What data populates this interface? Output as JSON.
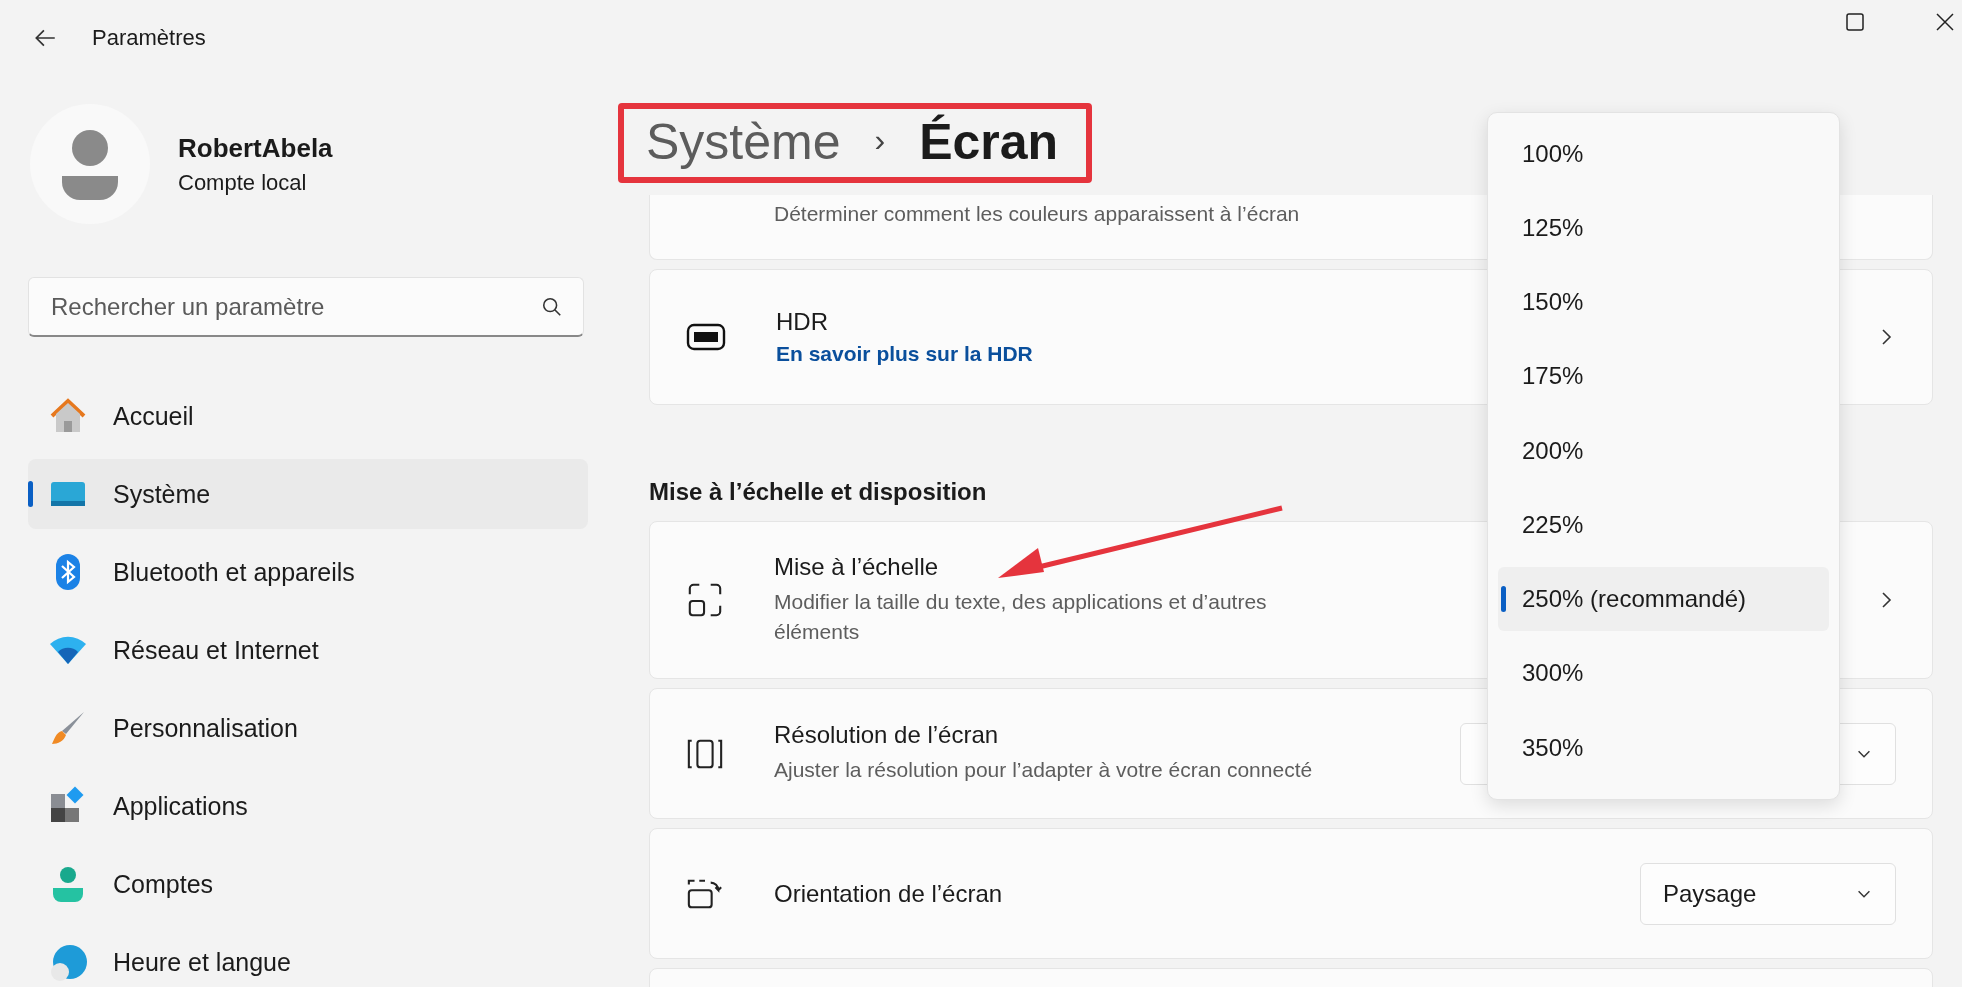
{
  "window": {
    "title": "Paramètres"
  },
  "profile": {
    "name": "RobertAbela",
    "account": "Compte local"
  },
  "search": {
    "placeholder": "Rechercher un paramètre"
  },
  "sidebar": {
    "items": [
      {
        "label": "Accueil",
        "selected": false
      },
      {
        "label": "Système",
        "selected": true
      },
      {
        "label": "Bluetooth et appareils",
        "selected": false
      },
      {
        "label": "Réseau et Internet",
        "selected": false
      },
      {
        "label": "Personnalisation",
        "selected": false
      },
      {
        "label": "Applications",
        "selected": false
      },
      {
        "label": "Comptes",
        "selected": false
      },
      {
        "label": "Heure et langue",
        "selected": false
      }
    ]
  },
  "breadcrumb": {
    "parent": "Système",
    "separator": "›",
    "current": "Écran",
    "highlighted": true
  },
  "cards": [
    {
      "kind": "partial",
      "description": "Déterminer comment les couleurs apparaissent à l’écran"
    },
    {
      "kind": "link",
      "title": "HDR",
      "link": "En savoir plus sur la HDR"
    },
    {
      "kind": "heading",
      "title": "Mise à l’échelle et disposition"
    },
    {
      "kind": "chevron",
      "title": "Mise à l’échelle",
      "description": "Modifier la taille du texte, des applications et d’autres éléments",
      "pointed_by_arrow": true
    },
    {
      "kind": "dropdown",
      "title": "Résolution de l’écran",
      "description": "Ajuster la résolution pour l’adapter à  votre  écran connecté"
    },
    {
      "kind": "dropdown",
      "title": "Orientation de l’écran",
      "value": "Paysage"
    },
    {
      "kind": "edge"
    }
  ],
  "scale_menu": {
    "options": [
      {
        "label": "100%",
        "selected": false
      },
      {
        "label": "125%",
        "selected": false
      },
      {
        "label": "150%",
        "selected": false
      },
      {
        "label": "175%",
        "selected": false
      },
      {
        "label": "200%",
        "selected": false
      },
      {
        "label": "225%",
        "selected": false
      },
      {
        "label": "250% (recommandé)",
        "selected": true
      },
      {
        "label": "300%",
        "selected": false
      },
      {
        "label": "350%",
        "selected": false
      }
    ]
  }
}
